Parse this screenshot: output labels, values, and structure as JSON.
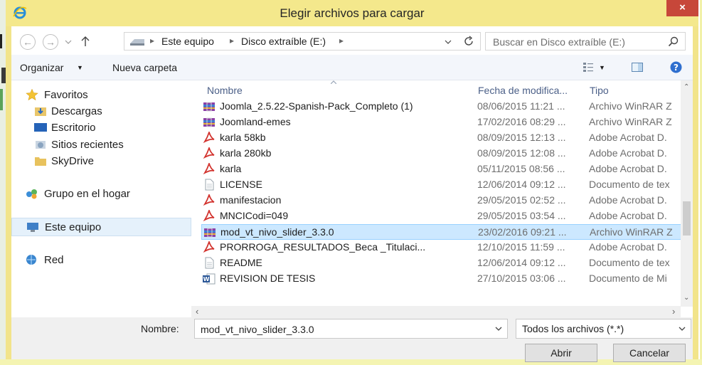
{
  "window": {
    "title": "Elegir archivos para cargar",
    "close_label": "×"
  },
  "address": {
    "breadcrumb": [
      "Este equipo",
      "Disco extraíble (E:)"
    ],
    "search_placeholder": "Buscar en Disco extraíble (E:)"
  },
  "toolbar": {
    "organize": "Organizar",
    "new_folder": "Nueva carpeta"
  },
  "nav": {
    "favorites": "Favoritos",
    "favorites_items": [
      "Descargas",
      "Escritorio",
      "Sitios recientes",
      "SkyDrive"
    ],
    "homegroup": "Grupo en el hogar",
    "this_pc": "Este equipo",
    "network": "Red"
  },
  "filelist": {
    "columns": {
      "name": "Nombre",
      "date": "Fecha de modifica...",
      "type": "Tipo"
    },
    "files": [
      {
        "name": "Joomla_2.5.22-Spanish-Pack_Completo (1)",
        "date": "08/06/2015 11:21 ...",
        "type": "Archivo WinRAR Z",
        "icon": "winrar-icon"
      },
      {
        "name": "Joomland-emes",
        "date": "17/02/2016 08:29 ...",
        "type": "Archivo WinRAR Z",
        "icon": "winrar-icon"
      },
      {
        "name": "karla 58kb",
        "date": "08/09/2015 12:13 ...",
        "type": "Adobe Acrobat D.",
        "icon": "pdf-icon"
      },
      {
        "name": "karla 280kb",
        "date": "08/09/2015 12:08 ...",
        "type": "Adobe Acrobat D.",
        "icon": "pdf-icon"
      },
      {
        "name": "karla",
        "date": "05/11/2015 08:56 ...",
        "type": "Adobe Acrobat D.",
        "icon": "pdf-icon"
      },
      {
        "name": "LICENSE",
        "date": "12/06/2014 09:12 ...",
        "type": "Documento de tex",
        "icon": "text-file-icon"
      },
      {
        "name": "manifestacion",
        "date": "29/05/2015 02:52 ...",
        "type": "Adobe Acrobat D.",
        "icon": "pdf-icon"
      },
      {
        "name": "MNCICodi=049",
        "date": "29/05/2015 03:54 ...",
        "type": "Adobe Acrobat D.",
        "icon": "pdf-icon"
      },
      {
        "name": "mod_vt_nivo_slider_3.3.0",
        "date": "23/02/2016 09:21 ...",
        "type": "Archivo WinRAR Z",
        "icon": "winrar-icon"
      },
      {
        "name": "PRORROGA_RESULTADOS_Beca _Titulaci...",
        "date": "12/10/2015 11:59 ...",
        "type": "Adobe Acrobat D.",
        "icon": "pdf-icon"
      },
      {
        "name": "README",
        "date": "12/06/2014 09:12 ...",
        "type": "Documento de tex",
        "icon": "text-file-icon"
      },
      {
        "name": "REVISION DE TESIS",
        "date": "27/10/2015 03:06 ...",
        "type": "Documento de Mi",
        "icon": "word-icon"
      }
    ]
  },
  "bottom": {
    "name_label": "Nombre:",
    "filename_value": "mod_vt_nivo_slider_3.3.0",
    "filetype_value": "Todos los archivos (*.*)",
    "open_label": "Abrir",
    "cancel_label": "Cancelar"
  },
  "colors": {
    "titlebar": "#f4e88c",
    "close": "#c7473a",
    "selection": "#cce8ff",
    "header_text": "#4c6088"
  }
}
